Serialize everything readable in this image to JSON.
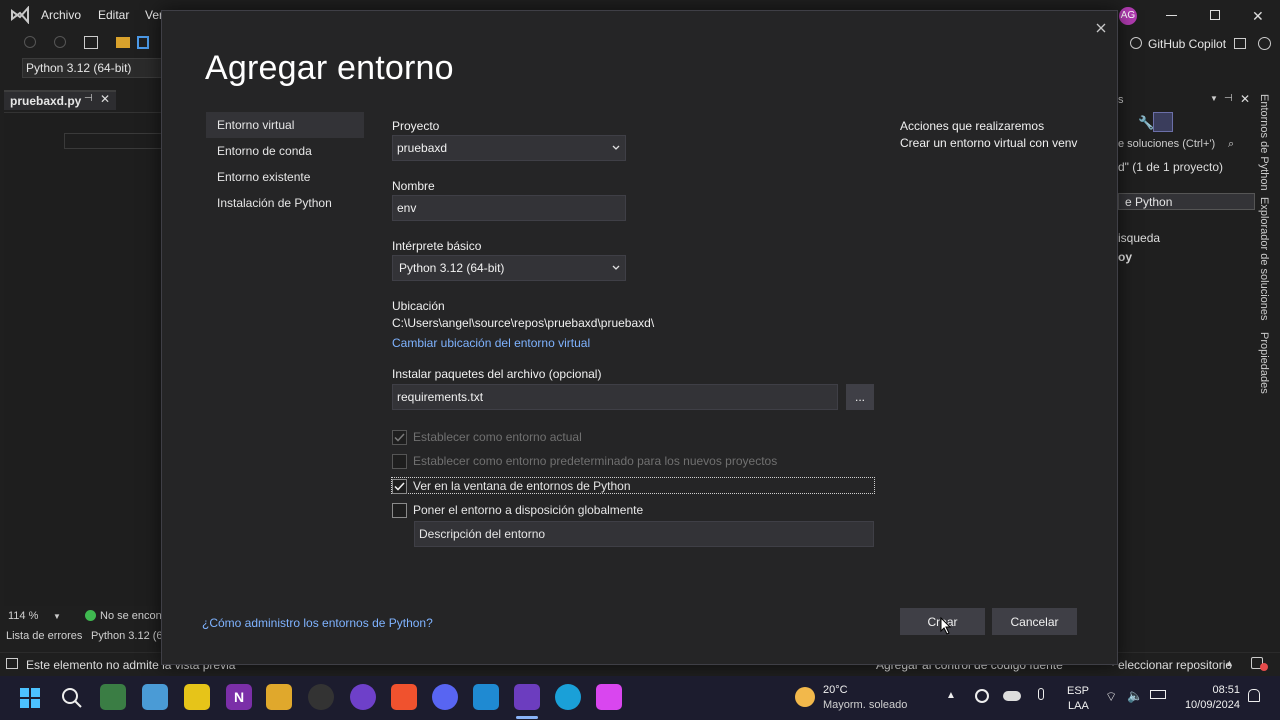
{
  "background_app": {
    "menu": [
      "Archivo",
      "Editar",
      "Ver"
    ],
    "interpreter_select": "Python 3.12 (64-bit)",
    "document_tab": "pruebaxd.py",
    "zoom": "114 %",
    "issues_status": "No se encon",
    "bottom_tabs": [
      "Lista de errores",
      "Python 3.12 (6"
    ],
    "status_message": "Este elemento no admite la vista previa",
    "status_source_control": "Agregar al control de código fuente",
    "status_repo": "eleccionar repositorio",
    "copilot_label": "GitHub Copilot",
    "user_initials": "AG",
    "right_panel": {
      "search_placeholder": "e soluciones (Ctrl+')",
      "solution_line": "d\" (1 de 1 proyecto)",
      "selected_item": "e Python",
      "item_busqueda": "isqueda",
      "item_py": "oy"
    },
    "vertical_tabs": [
      "Entornos de Python",
      "Explorador de soluciones",
      "Propiedades"
    ]
  },
  "dialog": {
    "title": "Agregar entorno",
    "nav": [
      {
        "label": "Entorno virtual",
        "active": true
      },
      {
        "label": "Entorno de conda",
        "active": false
      },
      {
        "label": "Entorno existente",
        "active": false
      },
      {
        "label": "Instalación de Python",
        "active": false
      }
    ],
    "project_label": "Proyecto",
    "project_value": "pruebaxd",
    "name_label": "Nombre",
    "name_value": "env",
    "interpreter_label": "Intérprete básico",
    "interpreter_value": "Python 3.12 (64-bit)",
    "location_label": "Ubicación",
    "location_value": "C:\\Users\\angel\\source\\repos\\pruebaxd\\pruebaxd\\",
    "change_location_link": "Cambiar ubicación del entorno virtual",
    "packages_label": "Instalar paquetes del archivo (opcional)",
    "packages_value": "requirements.txt",
    "browse_label": "...",
    "checkboxes": [
      {
        "label": "Establecer como entorno actual",
        "checked": true,
        "disabled": true
      },
      {
        "label": "Establecer como entorno predeterminado para los nuevos proyectos",
        "checked": false,
        "disabled": true
      },
      {
        "label": "Ver en la ventana de entornos de Python",
        "checked": true,
        "disabled": false
      },
      {
        "label": "Poner el entorno a disposición globalmente",
        "checked": false,
        "disabled": false
      }
    ],
    "description_placeholder": "Descripción del entorno",
    "actions_heading": "Acciones que realizaremos",
    "actions_item": "Crear un entorno virtual con venv",
    "help_link": "¿Cómo administro los entornos de Python?",
    "create_button": "Crear",
    "cancel_button": "Cancelar"
  },
  "taskbar": {
    "weather_temp": "20°C",
    "weather_desc": "Mayorm. soleado",
    "lang_top": "ESP",
    "lang_bottom": "LAA",
    "time": "08:51",
    "date": "10/09/2024"
  },
  "colors": {
    "dialog_bg": "#252526",
    "accent_link": "#7fb3ff",
    "taskbar_bg": "#1c1c2e"
  }
}
